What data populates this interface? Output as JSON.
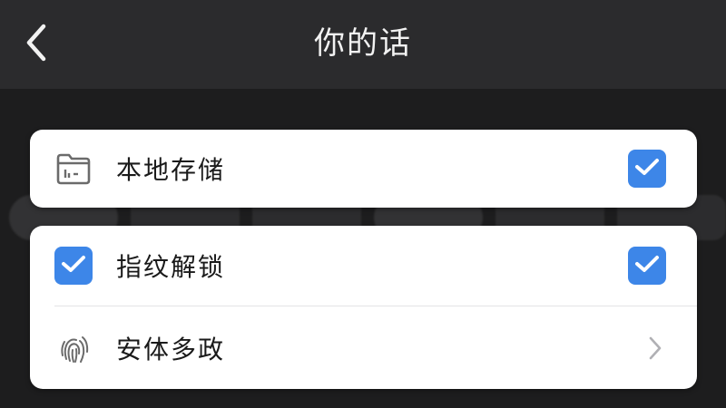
{
  "header": {
    "title": "你的话"
  },
  "storage_card": {
    "label": "本地存储",
    "checked": true
  },
  "security_card": {
    "fingerprint_unlock": {
      "label": "指纹解锁",
      "checked": true
    },
    "security_policy": {
      "label": "安体多政"
    }
  },
  "colors": {
    "accent": "#3d86e8",
    "navbar": "#2b2b2d",
    "background": "#1d1d1e",
    "card": "#ffffff"
  },
  "icons": {
    "back": "chevron-left-icon",
    "storage": "folder-icon",
    "fingerprint": "fingerprint-icon",
    "check": "check-icon",
    "next": "chevron-right-icon"
  }
}
